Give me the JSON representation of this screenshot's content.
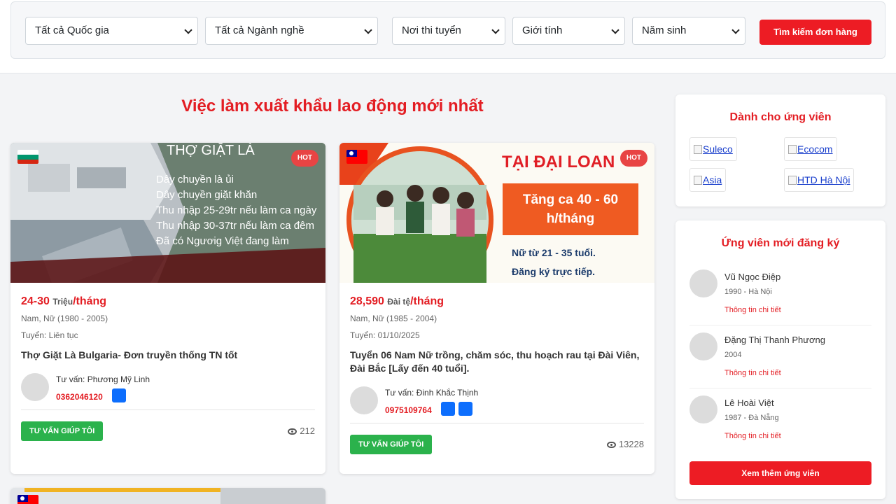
{
  "search": {
    "country": "Tất cả Quốc gia",
    "industry": "Tất cả Ngành nghề",
    "location": "Nơi thi tuyển",
    "gender": "Giới tính",
    "birth_year": "Năm sinh",
    "submit": "Tìm kiếm đơn hàng"
  },
  "section_title": "Việc làm xuất khẩu lao động mới nhất",
  "jobs": [
    {
      "country_flag": "bulgaria-flag",
      "badge": "HOT",
      "banner_heading": "THỢ GIẶT LÀ",
      "banner_points": [
        "Dây chuyền là ủi",
        "Dây chuyền giặt khăn",
        "Thu nhập 25-29tr nếu làm ca ngày",
        "Thu nhập 30-37tr nếu làm ca đêm",
        "Đã có Ngươig Việt đang làm"
      ],
      "salary_amount": "24-30",
      "salary_currency": "Triệu",
      "salary_period": "/tháng",
      "demographics": "Nam, Nữ (1980 - 2005)",
      "recruit_date": "Tuyển: Liên tục",
      "title": "Thợ Giặt Là Bulgaria- Đơn truyền thống TN tốt",
      "advisor": "Tư vấn: Phương Mỹ Linh",
      "phone": "0362046120",
      "advise_button": "TƯ VẤN GIÚP TÔI",
      "views": "212"
    },
    {
      "country_flag": "taiwan-flag",
      "badge": "HOT",
      "banner_heading": "TẠI ĐẠI LOAN",
      "banner_box": "Tăng ca 40 - 60 h/tháng",
      "banner_points": [
        "Nữ từ 21 - 35 tuổi.",
        "Đăng ký trực tiếp."
      ],
      "salary_amount": "28,590",
      "salary_currency": "Đài tệ",
      "salary_period": "/tháng",
      "demographics": "Nam, Nữ (1985 - 2004)",
      "recruit_date": "Tuyển: 01/10/2025",
      "title": "Tuyển 06 Nam Nữ trồng, chăm sóc, thu hoạch rau tại Đài Viên, Đài Bắc [Lấy đến 40 tuổi].",
      "advisor": "Tư vấn: Đinh Khắc Thịnh",
      "phone": "0975109764",
      "advise_button": "TƯ VẤN GIÚP TÔI",
      "views": "13228"
    }
  ],
  "sidebar": {
    "partners_title": "Dành cho ứng viên",
    "partners": [
      "Suleco",
      "Ecocom",
      "Asia",
      "HTD Hà Nội"
    ],
    "candidates_title": "Ứng viên mới đăng ký",
    "candidates": [
      {
        "name": "Vũ Ngọc Điệp",
        "info": "1990 - Hà Nội",
        "link": "Thông tin chi tiết"
      },
      {
        "name": "Đặng Thị Thanh Phương",
        "info": "2004",
        "link": "Thông tin chi tiết"
      },
      {
        "name": "Lê Hoài Việt",
        "info": "1987 - Đà Nẵng",
        "link": "Thông tin chi tiết"
      }
    ],
    "more_button": "Xem thêm ứng viên"
  },
  "colors": {
    "brand_red": "#ed1c24",
    "green_button": "#2bb24c",
    "chat_blue": "#0d6efd"
  }
}
